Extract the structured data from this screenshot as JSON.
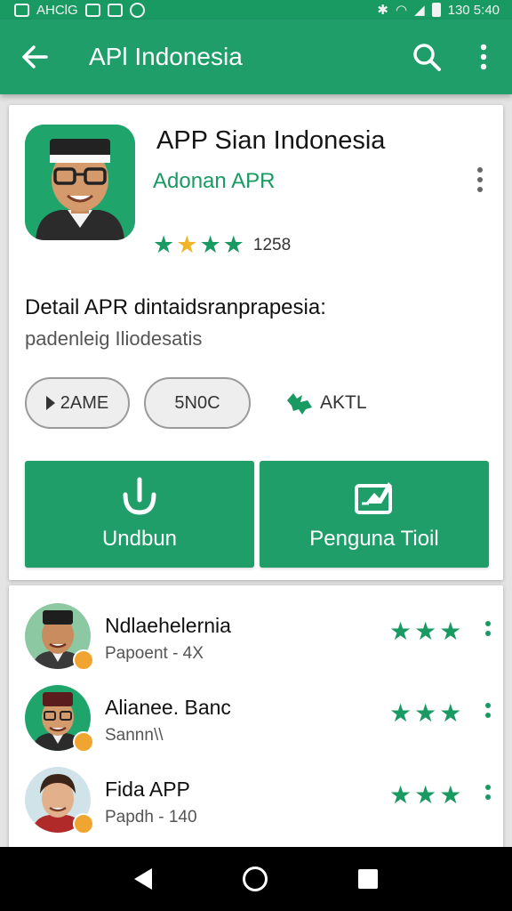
{
  "status_bar": {
    "left_text": "AHClG",
    "time": "130 5:40"
  },
  "app_bar": {
    "title": "APl Indonesia",
    "back_icon": "arrow-left-icon",
    "search_icon": "search-icon",
    "menu_icon": "more-vert-icon"
  },
  "app": {
    "name": "APP Sian Indonesia",
    "developer": "Adonan APR",
    "rating_stars": 4,
    "rating_count": "1258",
    "detail_title": "Detail APR dintaidsranprapesia:",
    "detail_subtitle": "padenleig Iliodesatis"
  },
  "chips": {
    "chip1": "2AME",
    "chip2": "5N0C",
    "plain": "AKTL"
  },
  "buttons": {
    "download": "Undbun",
    "guide": "Penguna Tioil"
  },
  "list": [
    {
      "name": "Ndlaehelernia",
      "sub": "Papoent - 4X",
      "stars": 3
    },
    {
      "name": "Alianee. Banc",
      "sub": "Sannn\\\\",
      "stars": 3
    },
    {
      "name": "Fida APP",
      "sub": "Papdh - 140",
      "stars": 3
    }
  ],
  "colors": {
    "brand": "#1f9e6a",
    "star_green": "#1a9a63",
    "star_gold": "#f0b429"
  }
}
